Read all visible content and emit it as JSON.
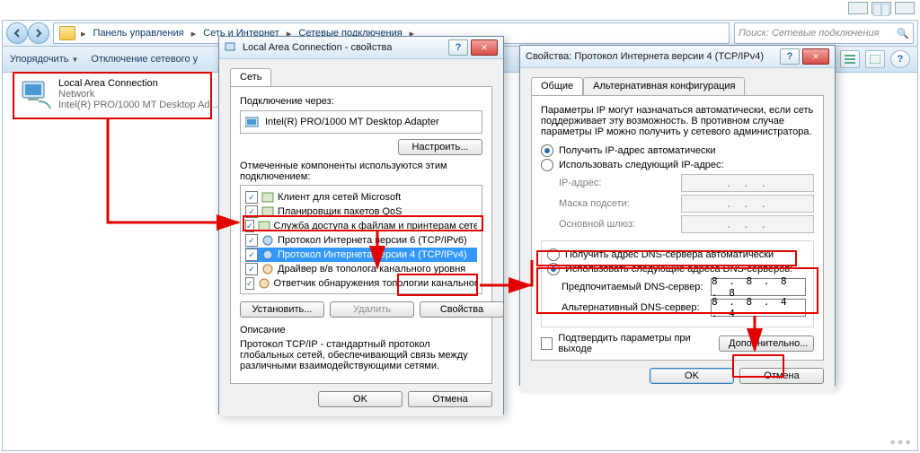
{
  "titlebar_buttons": [
    "min",
    "max",
    "close"
  ],
  "breadcrumb": {
    "items": [
      "Панель управления",
      "Сеть и Интернет",
      "Сетевые подключения"
    ]
  },
  "search": {
    "placeholder": "Поиск: Сетевые подключения"
  },
  "toolbar": {
    "organize": "Упорядочить",
    "disable": "Отключение сетевого у"
  },
  "adapter": {
    "name": "Local Area Connection",
    "type": "Network",
    "device": "Intel(R) PRO/1000 MT Desktop Ad..."
  },
  "dlg1": {
    "title": "Local Area Connection - свойства",
    "tab_network": "Сеть",
    "connect_via_label": "Подключение через:",
    "connect_via_value": "Intel(R) PRO/1000 MT Desktop Adapter",
    "configure_btn": "Настроить...",
    "components_label": "Отмеченные компоненты используются этим подключением:",
    "components": [
      "Клиент для сетей Microsoft",
      "Планировщик пакетов QoS",
      "Служба доступа к файлам и принтерам сетей Micro...",
      "Протокол Интернета версии 6 (TCP/IPv6)",
      "Протокол Интернета версии 4 (TCP/IPv4)",
      "Драйвер в/в тополога канального уровня",
      "Ответчик обнаружения топологии канального уровня"
    ],
    "install_btn": "Установить...",
    "uninstall_btn": "Удалить",
    "props_btn": "Свойства",
    "desc_title": "Описание",
    "desc_text": "Протокол TCP/IP - стандартный протокол глобальных сетей, обеспечивающий связь между различными взаимодействующими сетями.",
    "ok": "OK",
    "cancel": "Отмена"
  },
  "dlg2": {
    "title": "Свойства: Протокол Интернета версии 4 (TCP/IPv4)",
    "tab_general": "Общие",
    "tab_alt": "Альтернативная конфигурация",
    "intro": "Параметры IP могут назначаться автоматически, если сеть поддерживает эту возможность. В противном случае параметры IP можно получить у сетевого администратора.",
    "r_dhcp_ip": "Получить IP-адрес автоматически",
    "r_static_ip": "Использовать следующий IP-адрес:",
    "f_ip": "IP-адрес:",
    "f_mask": "Маска подсети:",
    "f_gw": "Основной шлюз:",
    "r_dhcp_dns": "Получить адрес DNS-сервера автоматически",
    "r_static_dns": "Использовать следующие адреса DNS-серверов:",
    "f_dns1": "Предпочитаемый DNS-сервер:",
    "f_dns2": "Альтернативный DNS-сервер:",
    "v_dns1": "8 . 8 . 8 . 8",
    "v_dns2": "8 . 8 . 4 . 4",
    "ip_placeholder": ".   .   .",
    "chk_validate": "Подтвердить параметры при выходе",
    "advanced": "Дополнительно...",
    "ok": "OK",
    "cancel": "Отмена"
  }
}
